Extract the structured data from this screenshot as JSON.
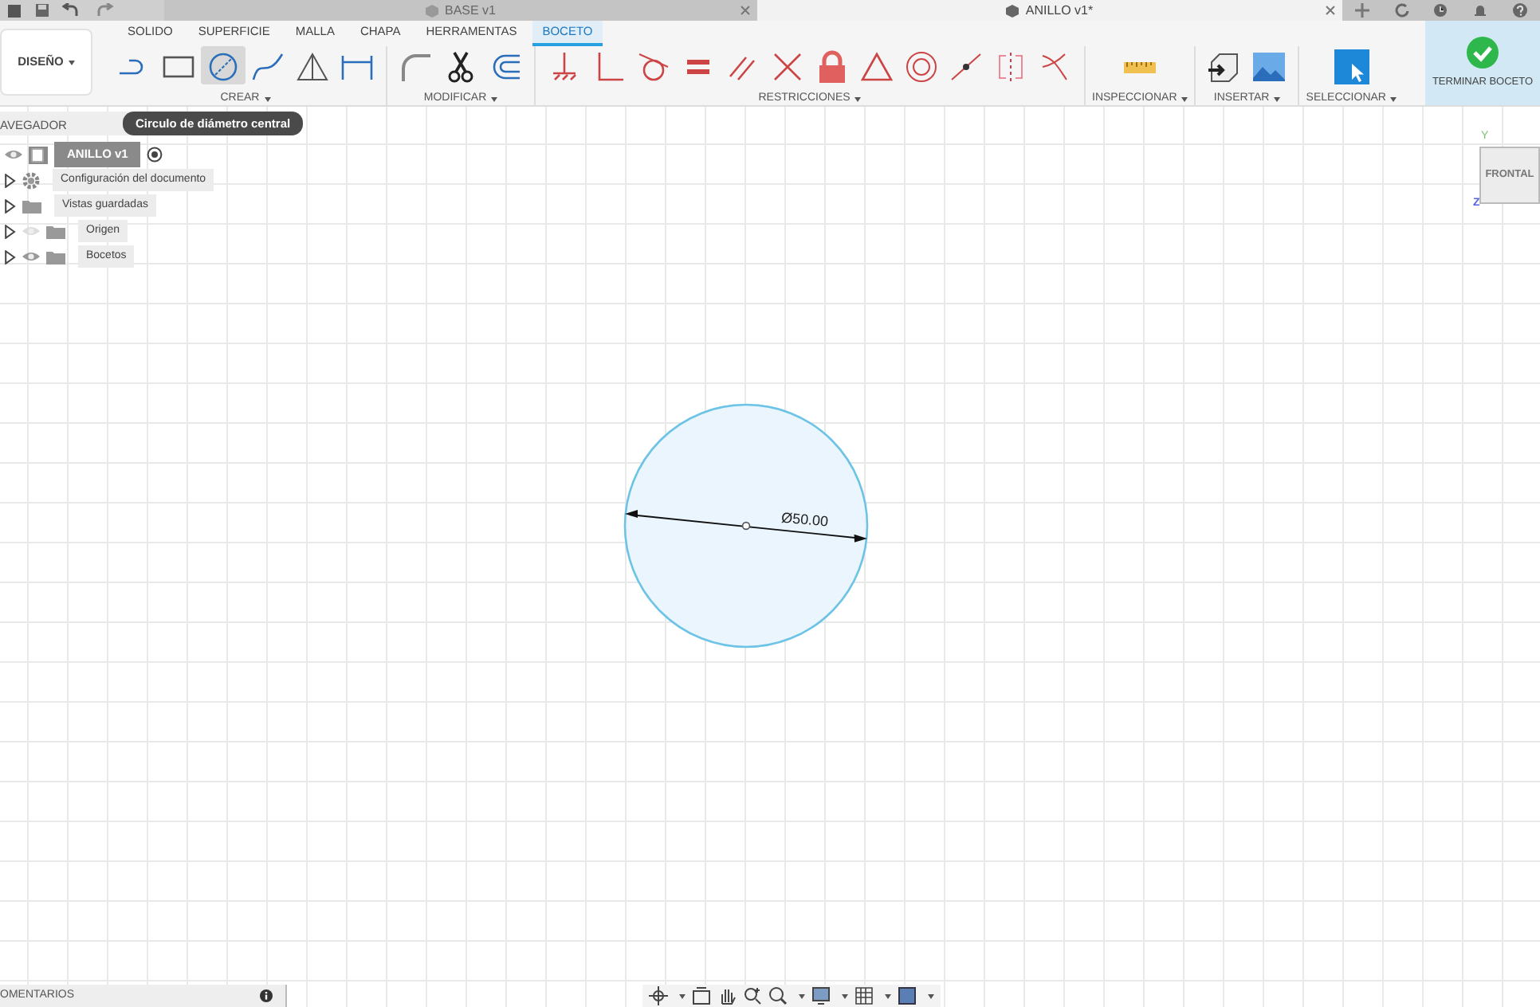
{
  "document_tabs": [
    {
      "title": "BASE v1",
      "selected": false
    },
    {
      "title": "ANILLO v1*",
      "selected": true
    }
  ],
  "workspace": {
    "label": "DISEÑO"
  },
  "ribbon_tabs": [
    {
      "label": "SOLIDO",
      "selected": false
    },
    {
      "label": "SUPERFICIE",
      "selected": false
    },
    {
      "label": "MALLA",
      "selected": false
    },
    {
      "label": "CHAPA",
      "selected": false
    },
    {
      "label": "HERRAMENTAS",
      "selected": false
    },
    {
      "label": "BOCETO",
      "selected": true
    }
  ],
  "tool_groups": [
    {
      "label": "CREAR",
      "tools": [
        {
          "selected": false
        },
        {
          "selected": false
        },
        {
          "selected": true
        },
        {
          "selected": false
        },
        {
          "selected": false
        },
        {
          "selected": false
        }
      ]
    },
    {
      "label": "MODIFICAR",
      "tools": [
        {
          "selected": false
        },
        {
          "selected": false
        },
        {
          "selected": false
        }
      ]
    },
    {
      "label": "RESTRICCIONES",
      "tools": [
        {
          "selected": false
        },
        {
          "selected": false
        },
        {
          "selected": false
        },
        {
          "selected": false
        },
        {
          "selected": false
        },
        {
          "selected": false
        },
        {
          "selected": false
        },
        {
          "selected": false
        },
        {
          "selected": false
        },
        {
          "selected": false
        },
        {
          "selected": false
        },
        {
          "selected": false
        }
      ]
    },
    {
      "label": "INSPECCIONAR",
      "tools": [
        {
          "selected": false
        }
      ]
    },
    {
      "label": "INSERTAR",
      "tools": [
        {
          "selected": false
        },
        {
          "selected": false
        }
      ]
    },
    {
      "label": "SELECCIONAR",
      "tools": [
        {
          "selected": false
        }
      ]
    }
  ],
  "finish_button": {
    "label": "TERMINAR BOCETO"
  },
  "tooltip": "Circulo de diámetro central",
  "browser": {
    "title": "AVEGADOR",
    "root": {
      "label": "ANILLO v1"
    },
    "items": [
      {
        "kind": "settings",
        "label": "Configuración del documento"
      },
      {
        "kind": "folder",
        "label": "Vistas guardadas"
      },
      {
        "kind": "folder",
        "label": "Origen",
        "visible": false
      },
      {
        "kind": "folder",
        "label": "Bocetos",
        "visible": true
      }
    ]
  },
  "sketch": {
    "dimension": "Ø50.00"
  },
  "view_cube": {
    "face": "FRONTAL",
    "axes": [
      "Y",
      "Z"
    ]
  },
  "comments": {
    "label": "OMENTARIOS"
  }
}
